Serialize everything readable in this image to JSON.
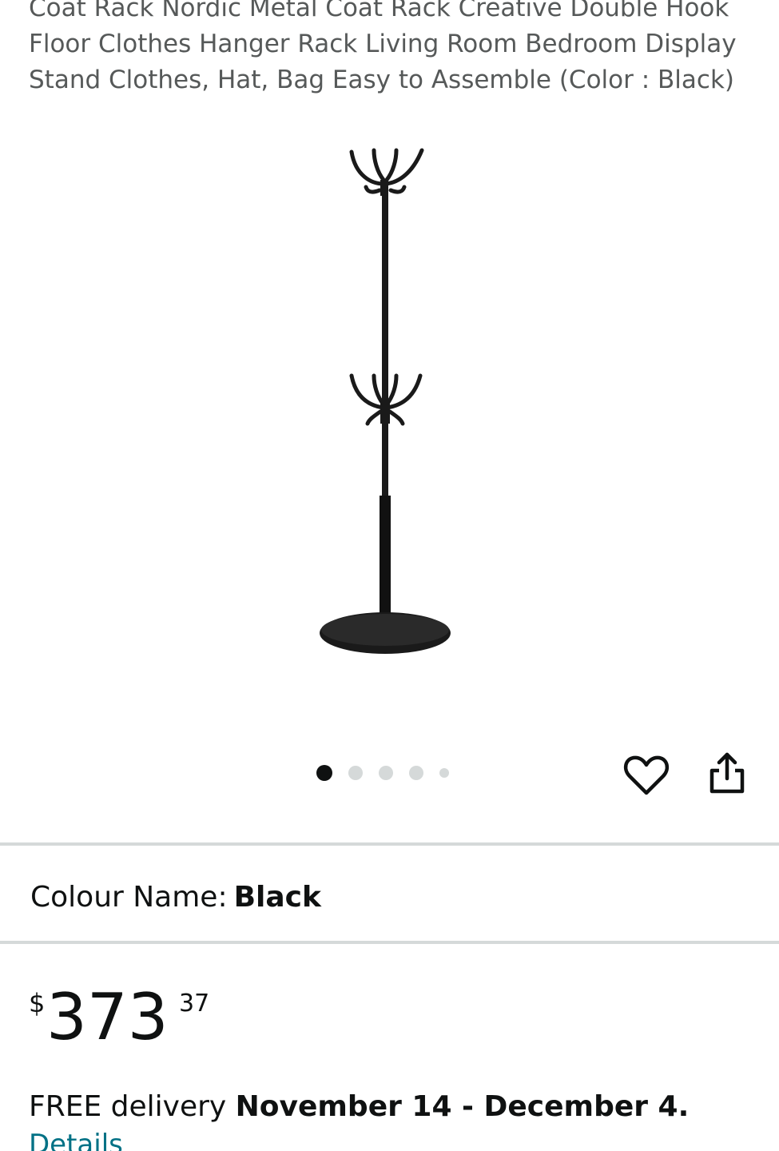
{
  "product": {
    "title": "Coat Rack Nordic Metal Coat Rack Creative Double Hook Floor Clothes Hanger Rack Living Room Bedroom Display Stand Clothes, Hat, Bag Easy to Assemble (Color : Black)",
    "image_icon": "coat-rack-image"
  },
  "gallery": {
    "total_images": 5,
    "active_index": 0
  },
  "actions": {
    "wishlist_icon": "heart-icon",
    "share_icon": "share-icon"
  },
  "variation": {
    "label": "Colour Name:",
    "value": "Black"
  },
  "price": {
    "symbol": "$",
    "whole": "373",
    "fraction": "37"
  },
  "delivery": {
    "prefix": "FREE delivery",
    "date_range": "November 14 - December 4.",
    "details_link": "Details"
  },
  "colors": {
    "text": "#0f1111",
    "title_text": "#565959",
    "link": "#007185",
    "divider": "#d5d9d9"
  }
}
